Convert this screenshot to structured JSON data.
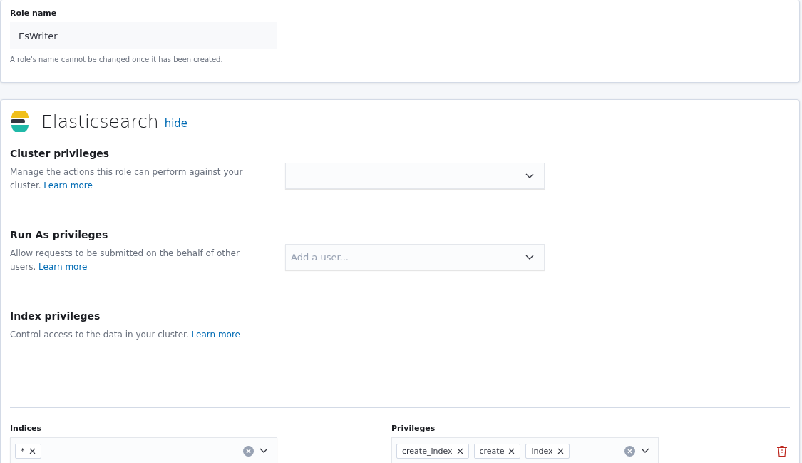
{
  "role_name": {
    "label": "Role name",
    "value": "EsWriter",
    "help": "A role's name cannot be changed once it has been created."
  },
  "elasticsearch": {
    "title": "Elasticsearch",
    "toggle_link": "hide",
    "sections": [
      {
        "title": "Cluster privileges",
        "description": "Manage the actions this role can perform against your cluster.",
        "link": "Learn more",
        "field": {
          "kind": "combo"
        }
      },
      {
        "title": "Run As privileges",
        "description": "Allow requests to be submitted on the behalf of other users.",
        "link": "Learn more",
        "field": {
          "kind": "combo",
          "placeholder": "Add a user..."
        }
      },
      {
        "title": "Index privileges",
        "description": "Control access to the data in your cluster.",
        "link": "Learn more",
        "field": {
          "kind": "none"
        }
      }
    ],
    "index_row": {
      "indices": {
        "label": "Indices",
        "tags": [
          "*"
        ]
      },
      "privileges": {
        "label": "Privileges",
        "tags": [
          "create_index",
          "create",
          "index"
        ]
      }
    }
  }
}
